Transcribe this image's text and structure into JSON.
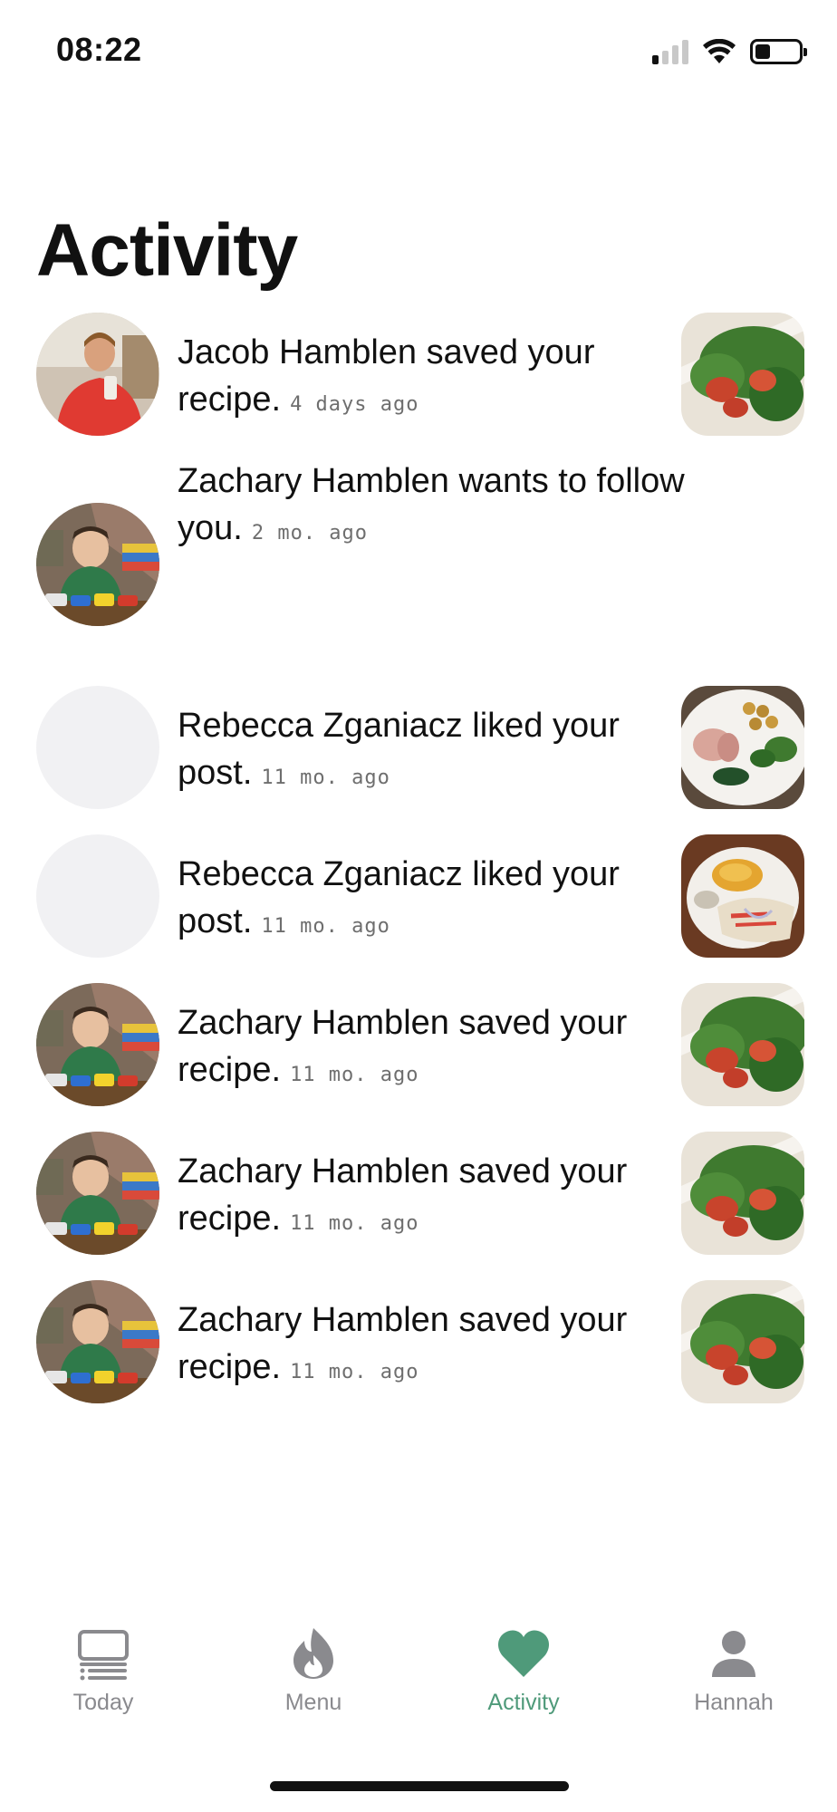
{
  "status_bar": {
    "time": "08:22",
    "signal_bars_active": 1,
    "battery_level": 0.3,
    "icons": [
      "signal-icon",
      "wifi-icon",
      "battery-icon"
    ]
  },
  "page": {
    "title": "Activity"
  },
  "activities": [
    {
      "message": "Jacob Hamblen saved your recipe.",
      "time": "4 days ago",
      "avatar": "photo-person-red-shirt",
      "thumbnail": "photo-salad"
    },
    {
      "message": "Zachary Hamblen wants to follow you.",
      "time": "2 mo. ago",
      "avatar": "photo-child-toy-cars",
      "thumbnail": null
    },
    {
      "message": "Rebecca Zganiacz liked your post.",
      "time": "11 mo. ago",
      "avatar": null,
      "thumbnail": "photo-plate-meat-veg"
    },
    {
      "message": "Rebecca Zganiacz liked your post.",
      "time": "11 mo. ago",
      "avatar": null,
      "thumbnail": "photo-plate-rice-wrap"
    },
    {
      "message": "Zachary Hamblen saved your recipe.",
      "time": "11 mo. ago",
      "avatar": "photo-child-toy-cars",
      "thumbnail": "photo-salad"
    },
    {
      "message": "Zachary Hamblen saved your recipe.",
      "time": "11 mo. ago",
      "avatar": "photo-child-toy-cars",
      "thumbnail": "photo-salad"
    },
    {
      "message": "Zachary Hamblen saved your recipe.",
      "time": "11 mo. ago",
      "avatar": "photo-child-toy-cars",
      "thumbnail": "photo-salad"
    }
  ],
  "tab_bar": {
    "active": "activity",
    "accent_color": "#4f9a7a",
    "inactive_color": "#8a8a8e",
    "tabs": [
      {
        "id": "today",
        "label": "Today",
        "icon": "laptop-list-icon"
      },
      {
        "id": "menu",
        "label": "Menu",
        "icon": "flame-icon"
      },
      {
        "id": "activity",
        "label": "Activity",
        "icon": "heart-icon"
      },
      {
        "id": "profile",
        "label": "Hannah",
        "icon": "person-icon"
      }
    ]
  }
}
